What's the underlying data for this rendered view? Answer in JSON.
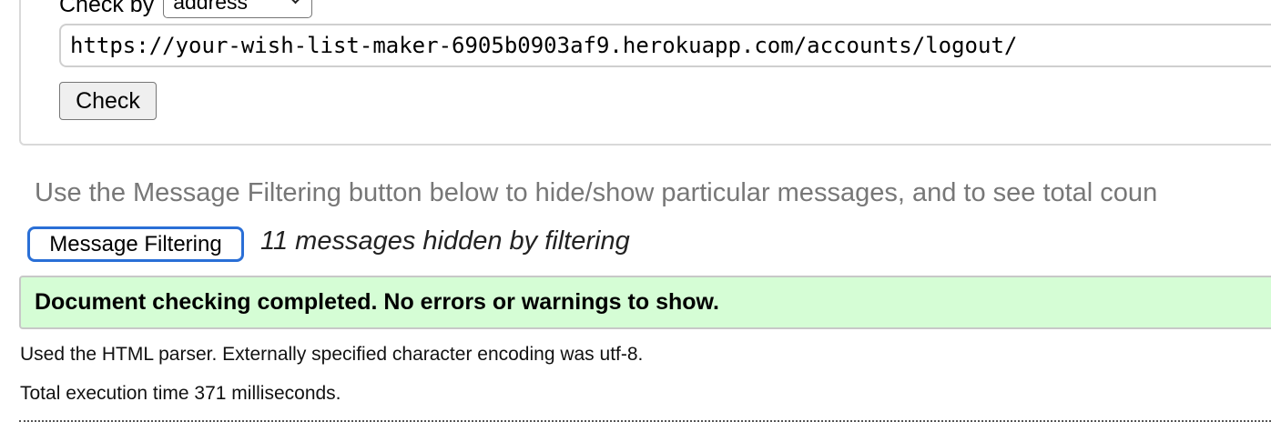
{
  "form": {
    "check_by_label": "Check by",
    "check_by_selected": "address",
    "url_value": "https://your-wish-list-maker-6905b0903af9.herokuapp.com/accounts/logout/",
    "check_button": "Check"
  },
  "filtering": {
    "hint": "Use the Message Filtering button below to hide/show particular messages, and to see total coun",
    "button": "Message Filtering",
    "hidden_count": "11 messages hidden by filtering"
  },
  "result": {
    "status": "Document checking completed. No errors or warnings to show.",
    "status_color": "#d5fdd5"
  },
  "info": {
    "parser": "Used the HTML parser. Externally specified character encoding was utf-8.",
    "time": "Total execution time 371 milliseconds."
  }
}
